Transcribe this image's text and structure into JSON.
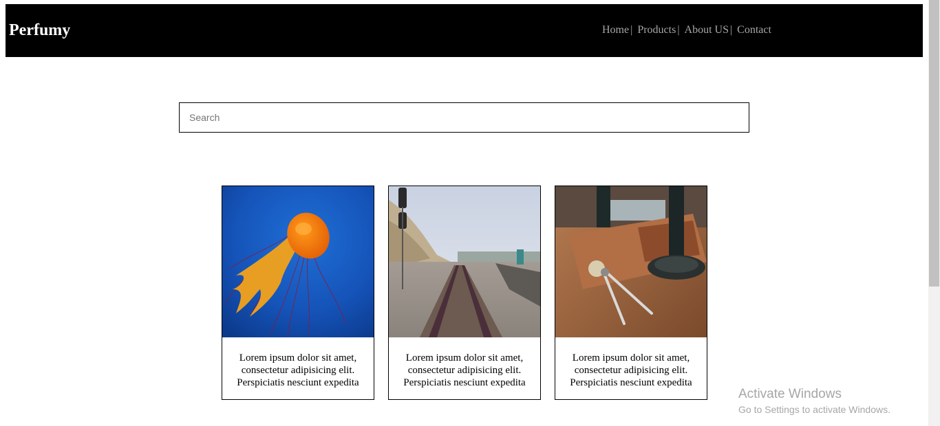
{
  "brand": "Perfumy",
  "nav": {
    "items": [
      {
        "label": "Home",
        "sep": "|"
      },
      {
        "label": "Products",
        "sep": "|"
      },
      {
        "label": "About US",
        "sep": "|"
      },
      {
        "label": "Contact",
        "sep": ""
      }
    ]
  },
  "search": {
    "placeholder": "Search",
    "value": ""
  },
  "cards": [
    {
      "image": "jellyfish-photo",
      "text": "Lorem ipsum dolor sit amet, consectetur adipisicing elit. Perspiciatis nesciunt expedita"
    },
    {
      "image": "railway-track-photo",
      "text": "Lorem ipsum dolor sit amet, consectetur adipisicing elit. Perspiciatis nesciunt expedita"
    },
    {
      "image": "desk-tools-photo",
      "text": "Lorem ipsum dolor sit amet, consectetur adipisicing elit. Perspiciatis nesciunt expedita"
    }
  ],
  "watermark": {
    "title": "Activate Windows",
    "subtitle": "Go to Settings to activate Windows."
  },
  "colors": {
    "navbar": "#000000",
    "nav_link": "#a7a7a7",
    "brand": "#ffffff",
    "border": "#000000"
  }
}
